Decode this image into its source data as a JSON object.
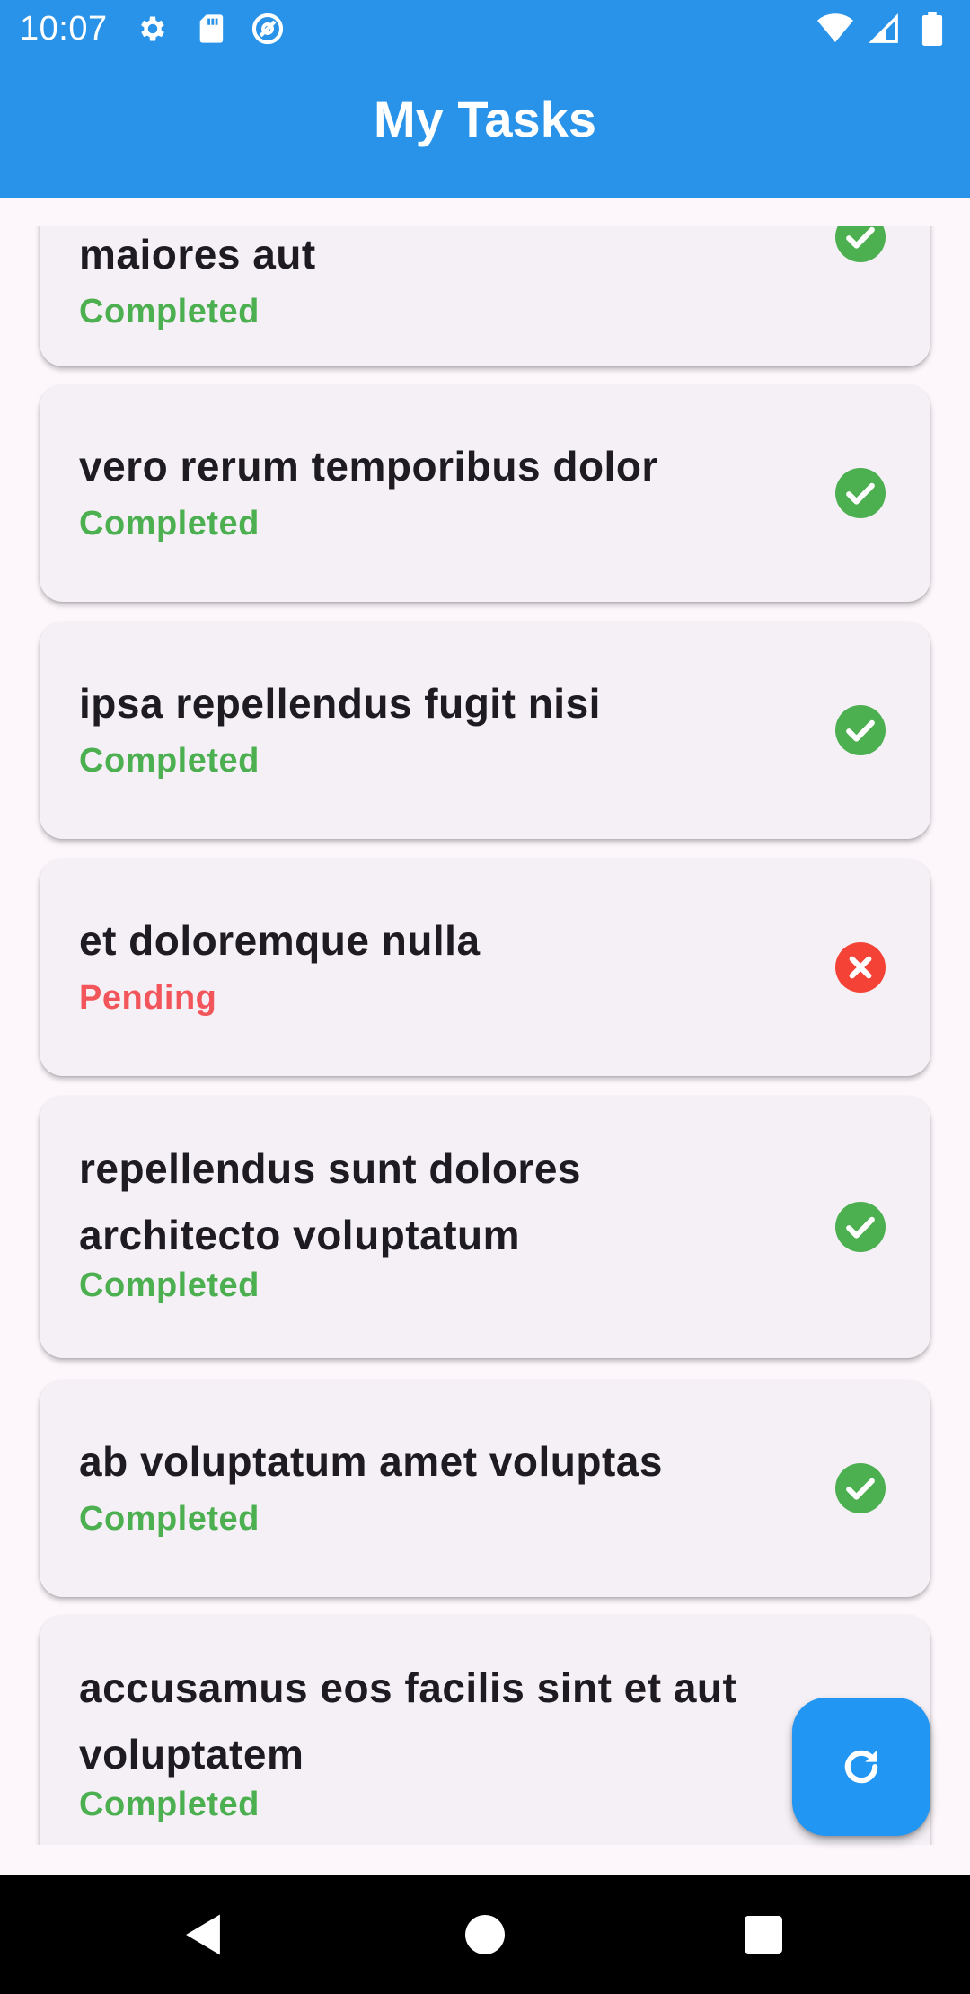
{
  "status_bar": {
    "time": "10:07",
    "left_icons": [
      "settings-icon",
      "sd-card-icon",
      "at-sign-icon"
    ],
    "right_icons": [
      "wifi-icon",
      "cell-signal-icon",
      "battery-icon"
    ]
  },
  "app_bar": {
    "title": "My Tasks"
  },
  "tasks": [
    {
      "title": "maiores aut",
      "status": "Completed",
      "done": true
    },
    {
      "title": "vero rerum temporibus dolor",
      "status": "Completed",
      "done": true
    },
    {
      "title": "ipsa repellendus fugit nisi",
      "status": "Completed",
      "done": true
    },
    {
      "title": "et doloremque nulla",
      "status": "Pending",
      "done": false
    },
    {
      "title": "repellendus sunt dolores architecto voluptatum",
      "status": "Completed",
      "done": true
    },
    {
      "title": "ab voluptatum amet voluptas",
      "status": "Completed",
      "done": true
    },
    {
      "title": "accusamus eos facilis sint et aut voluptatem",
      "status": "Completed",
      "done": true
    }
  ],
  "fab": {
    "icon": "refresh-icon"
  },
  "nav_bar": {
    "buttons": [
      "back-icon",
      "home-icon",
      "recents-icon"
    ]
  },
  "colors": {
    "primary": "#2993e9",
    "completed": "#4caf50",
    "pending": "#f2555a",
    "card": "#f4f0f6",
    "fab": "#2196f3"
  }
}
